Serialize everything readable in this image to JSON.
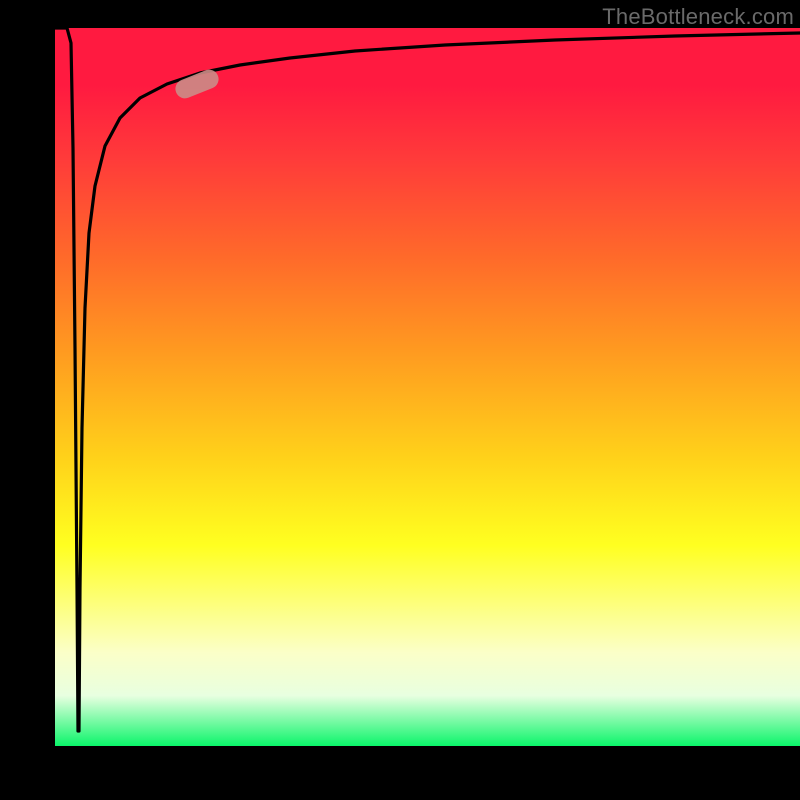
{
  "watermark": "TheBottleneck.com",
  "colors": {
    "background": "#000000",
    "gradient_top": "#ff1a40",
    "gradient_mid1": "#ff9a20",
    "gradient_mid2": "#ffff20",
    "gradient_bottom": "#0bf56a",
    "curve": "#000000",
    "marker": "#cc8c88"
  },
  "chart_data": {
    "type": "line",
    "title": "",
    "xlabel": "",
    "ylabel": "",
    "xlim": [
      0,
      100
    ],
    "ylim": [
      0,
      100
    ],
    "grid": false,
    "note": "Axes unlabeled; values estimated from pixel positions on a 0–100 normalized scale. Curve visually: a near-vertical spike near x≈3 down to y≈0, then back up and a log-like approach toward y≈100.",
    "series": [
      {
        "name": "curve",
        "x": [
          0,
          1.5,
          2.2,
          2.8,
          3.0,
          3.2,
          3.6,
          4.2,
          5.0,
          6.5,
          8.5,
          11,
          14,
          18,
          23,
          30,
          40,
          55,
          75,
          100
        ],
        "y": [
          100,
          100,
          80,
          30,
          2,
          30,
          55,
          70,
          78,
          84,
          88,
          90.5,
          92.5,
          94,
          95.3,
          96.4,
          97.4,
          98.2,
          98.8,
          99.2
        ]
      }
    ],
    "marker": {
      "x": 18,
      "y": 92,
      "shape": "pill",
      "color": "#cc8c88"
    }
  }
}
